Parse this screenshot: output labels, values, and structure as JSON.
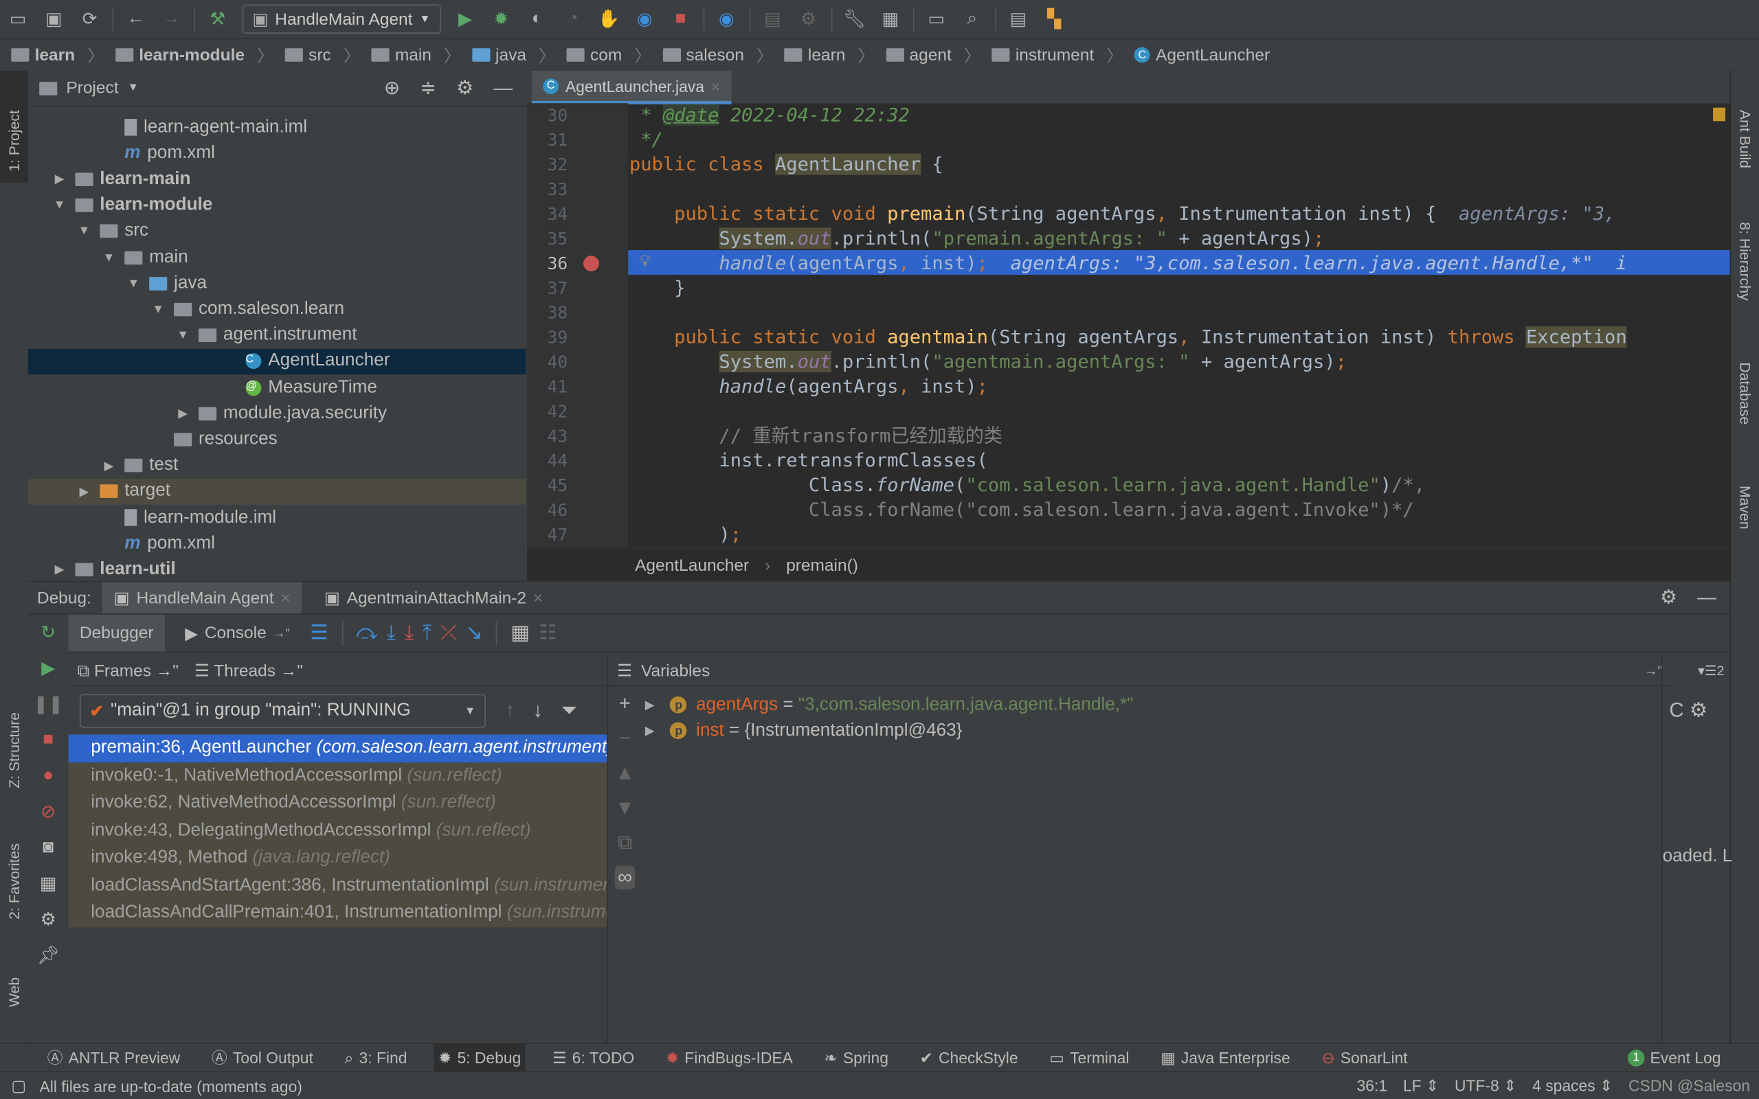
{
  "toolbar": {
    "run_config": "HandleMain Agent"
  },
  "breadcrumbs": [
    "learn",
    "learn-module",
    "src",
    "main",
    "java",
    "com",
    "saleson",
    "learn",
    "agent",
    "instrument",
    "AgentLauncher"
  ],
  "project": {
    "title": "Project",
    "items": [
      {
        "label": "learn-agent-main.iml",
        "depth": 3,
        "icon": "iml-file-icon",
        "arrow": ""
      },
      {
        "label": "pom.xml",
        "depth": 3,
        "icon": "maven-file-icon",
        "arrow": ""
      },
      {
        "label": "learn-main",
        "depth": 1,
        "icon": "module-folder-icon",
        "arrow": "right",
        "bold": true
      },
      {
        "label": "learn-module",
        "depth": 1,
        "icon": "module-folder-icon",
        "arrow": "down",
        "bold": true
      },
      {
        "label": "src",
        "depth": 2,
        "icon": "folder-icon",
        "arrow": "down"
      },
      {
        "label": "main",
        "depth": 3,
        "icon": "folder-icon",
        "arrow": "down"
      },
      {
        "label": "java",
        "depth": 4,
        "icon": "source-folder-icon",
        "arrow": "down"
      },
      {
        "label": "com.saleson.learn",
        "depth": 5,
        "icon": "package-icon",
        "arrow": "down"
      },
      {
        "label": "agent.instrument",
        "depth": 6,
        "icon": "package-icon",
        "arrow": "down"
      },
      {
        "label": "AgentLauncher",
        "depth": 8,
        "icon": "class-icon",
        "arrow": "",
        "selected": true
      },
      {
        "label": "MeasureTime",
        "depth": 8,
        "icon": "annotation-icon",
        "arrow": ""
      },
      {
        "label": "module.java.security",
        "depth": 6,
        "icon": "package-icon",
        "arrow": "right"
      },
      {
        "label": "resources",
        "depth": 5,
        "icon": "resources-folder-icon",
        "arrow": ""
      },
      {
        "label": "test",
        "depth": 3,
        "icon": "folder-icon",
        "arrow": "right"
      },
      {
        "label": "target",
        "depth": 2,
        "icon": "excluded-folder-icon",
        "arrow": "right",
        "target": true
      },
      {
        "label": "learn-module.iml",
        "depth": 3,
        "icon": "iml-file-icon",
        "arrow": ""
      },
      {
        "label": "pom.xml",
        "depth": 3,
        "icon": "maven-file-icon",
        "arrow": ""
      },
      {
        "label": "learn-util",
        "depth": 1,
        "icon": "module-folder-icon",
        "arrow": "right",
        "bold": true
      }
    ]
  },
  "editor": {
    "tab": "AgentLauncher.java",
    "breadcrumb": [
      "AgentLauncher",
      "premain()"
    ],
    "lines": [
      {
        "n": "30",
        "html": "<span class='doc'> * </span><span class='doc hl' style='text-decoration:underline'>@date</span><span class='doc'> 2022-04-12 22:32</span>"
      },
      {
        "n": "31",
        "html": "<span class='doc'> */</span>"
      },
      {
        "n": "32",
        "html": "<span class='kw'>public class </span><span class='hlu'>AgentLauncher</span> {"
      },
      {
        "n": "33",
        "html": ""
      },
      {
        "n": "34",
        "html": "    <span class='kw'>public static void </span><span class='fn'>premain</span>(String agentArgs<span class='kw'>, </span>Instrumentation inst) {  <span class='hint'>agentArgs: \"3,</span>"
      },
      {
        "n": "35",
        "html": "        <span class='hlu'>System.<span class='fld'>out</span></span>.println(<span class='str'>\"premain.agentArgs: \"</span> + agentArgs)<span class='kw'>;</span>"
      },
      {
        "n": "36",
        "html": "        <span class='it'>handle</span>(agentArgs<span class='kw'>, </span>inst)<span class='kw'>;</span>  <span class='hint' style='color:#b8c4dc'>agentArgs: \"3,com.saleson.learn.java.agent.Handle,*\"  i</span>"
      },
      {
        "n": "37",
        "html": "    }"
      },
      {
        "n": "38",
        "html": ""
      },
      {
        "n": "39",
        "html": "    <span class='kw'>public static void </span><span class='fn'>agentmain</span>(String agentArgs<span class='kw'>, </span>Instrumentation inst) <span class='kw'>throws </span><span class='hlu'>Exception</span>"
      },
      {
        "n": "40",
        "html": "        <span class='hlu'>System.<span class='fld'>out</span></span>.println(<span class='str'>\"agentmain.agentArgs: \"</span> + agentArgs)<span class='kw'>;</span>"
      },
      {
        "n": "41",
        "html": "        <span class='it'>handle</span>(agentArgs<span class='kw'>, </span>inst)<span class='kw'>;</span>"
      },
      {
        "n": "42",
        "html": ""
      },
      {
        "n": "43",
        "html": "        <span class='cm'>// 重新transform已经加载的类</span>"
      },
      {
        "n": "44",
        "html": "        inst.retransformClasses("
      },
      {
        "n": "45",
        "html": "                Class.<span class='it'>forName</span>(<span class='str'>\"com.saleson.learn.java.agent.Handle\"</span>)<span class='cm'>/*,</span>"
      },
      {
        "n": "46",
        "html": "<span class='cm'>                Class.forName(\"com.saleson.learn.java.agent.Invoke\")*/</span>"
      },
      {
        "n": "47",
        "html": "        )<span class='kw'>;</span>"
      }
    ]
  },
  "right_strip": [
    "Ant Build",
    "8: Hierarchy",
    "Database",
    "Maven"
  ],
  "left_strip": [
    "1: Project",
    "Z: Structure",
    "2: Favorites",
    "Web"
  ],
  "debug": {
    "label": "Debug:",
    "tabs": [
      "HandleMain Agent",
      "AgentmainAttachMain-2"
    ],
    "debugger_tab": "Debugger",
    "console_tab": "Console",
    "frames_tab": "Frames",
    "threads_tab": "Threads",
    "variables_title": "Variables",
    "thread": "\"main\"@1 in group \"main\": RUNNING",
    "frames": [
      {
        "m": "premain:36, AgentLauncher ",
        "p": "(com.saleson.learn.agent.instrument)"
      },
      {
        "m": "invoke0:-1, NativeMethodAccessorImpl ",
        "p": "(sun.reflect)"
      },
      {
        "m": "invoke:62, NativeMethodAccessorImpl ",
        "p": "(sun.reflect)"
      },
      {
        "m": "invoke:43, DelegatingMethodAccessorImpl ",
        "p": "(sun.reflect)"
      },
      {
        "m": "invoke:498, Method ",
        "p": "(java.lang.reflect)"
      },
      {
        "m": "loadClassAndStartAgent:386, InstrumentationImpl ",
        "p": "(sun.instrument)"
      },
      {
        "m": "loadClassAndCallPremain:401, InstrumentationImpl ",
        "p": "(sun.instrument)"
      }
    ],
    "variables": [
      {
        "name": "agentArgs",
        "eq": " = ",
        "value": "\"3,com.saleson.learn.java.agent.Handle,*\"",
        "isString": true
      },
      {
        "name": "inst",
        "eq": " = ",
        "value": "{InstrumentationImpl@463}",
        "isString": false
      }
    ],
    "right_text": "oaded. L",
    "right_count": "2"
  },
  "bottom_tabs": [
    {
      "label": "ANTLR Preview",
      "icon": "antlr-icon"
    },
    {
      "label": "Tool Output",
      "icon": "tool-output-icon"
    },
    {
      "label": "3: Find",
      "icon": "search-icon"
    },
    {
      "label": "5: Debug",
      "icon": "bug-icon",
      "active": true
    },
    {
      "label": "6: TODO",
      "icon": "list-icon"
    },
    {
      "label": "FindBugs-IDEA",
      "icon": "findbugs-icon"
    },
    {
      "label": "Spring",
      "icon": "spring-icon"
    },
    {
      "label": "CheckStyle",
      "icon": "checkstyle-icon"
    },
    {
      "label": "Terminal",
      "icon": "terminal-icon"
    },
    {
      "label": "Java Enterprise",
      "icon": "java-ee-icon"
    },
    {
      "label": "SonarLint",
      "icon": "sonarlint-icon"
    }
  ],
  "event_log": {
    "count": "1",
    "label": "Event Log"
  },
  "status": {
    "message": "All files are up-to-date (moments ago)",
    "position": "36:1",
    "line_sep": "LF",
    "encoding": "UTF-8",
    "indent": "4 spaces",
    "watermark": "CSDN @Saleson"
  }
}
